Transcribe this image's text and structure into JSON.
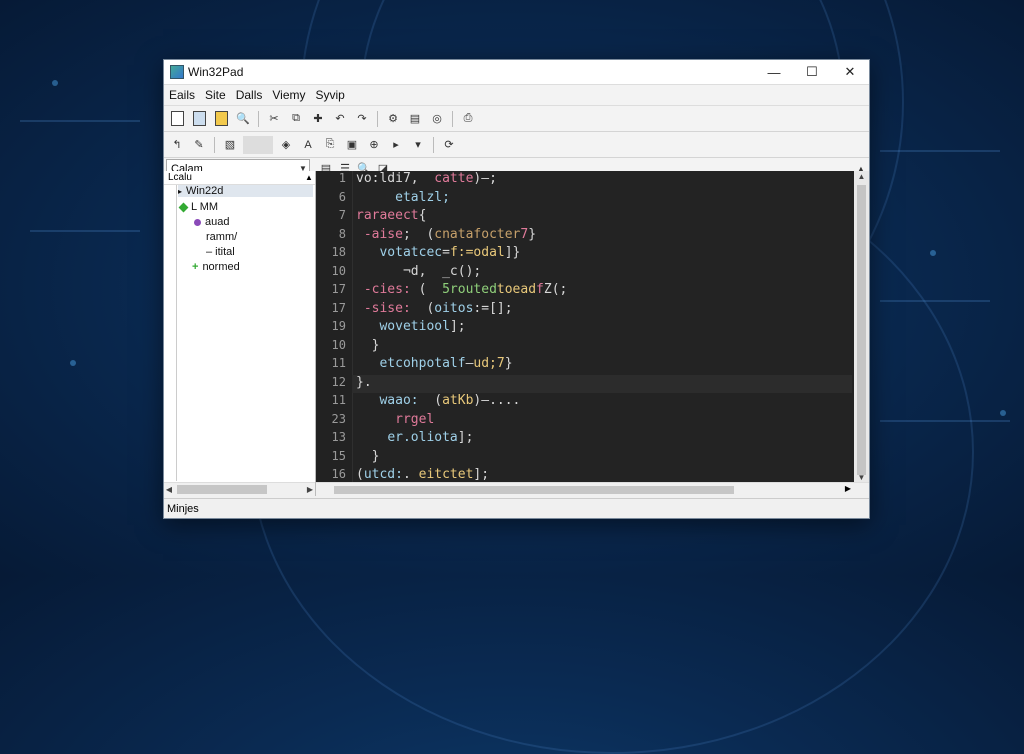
{
  "window": {
    "title": "Win32Pad",
    "controls": {
      "minimize": "—",
      "maximize": "☐",
      "close": "✕"
    }
  },
  "menu": [
    "Eails",
    "Site",
    "Dalls",
    "Viemy",
    "Syvip"
  ],
  "addressbar": {
    "combo_value": "Calam"
  },
  "tree": {
    "header": "Lcalu",
    "items": [
      {
        "label": "Win22d",
        "marker": "",
        "selected": true
      },
      {
        "label": "L  MM",
        "marker": "green"
      },
      {
        "label": "auad",
        "marker": "purple"
      },
      {
        "label": "ramm/",
        "marker": ""
      },
      {
        "label": "– itital",
        "marker": ""
      },
      {
        "label": "normed",
        "marker": "green-plus"
      }
    ]
  },
  "editor": {
    "line_numbers": [
      "1",
      "6",
      "7",
      "8",
      "18",
      "10",
      "17",
      "17",
      "19",
      "10",
      "11",
      "12",
      "11",
      "23",
      "13",
      "15",
      "16"
    ],
    "current_line_index": 11,
    "lines": [
      {
        "parts": [
          [
            "",
            "vo:ldi7,  "
          ],
          [
            "kw",
            "catte"
          ],
          [
            "",
            ")–;"
          ]
        ]
      },
      {
        "parts": [
          [
            "",
            "     "
          ],
          [
            "cy",
            "etalzl;"
          ]
        ]
      },
      {
        "parts": [
          [
            "kw",
            "raraeect"
          ],
          [
            "",
            "{"
          ]
        ]
      },
      {
        "parts": [
          [
            "",
            " "
          ],
          [
            "kw",
            "-aise"
          ],
          [
            "",
            ";  ("
          ],
          [
            "str",
            "cnatafocter"
          ],
          [
            "kw",
            "7"
          ],
          [
            "",
            "}"
          ]
        ]
      },
      {
        "parts": [
          [
            "",
            "   "
          ],
          [
            "cy",
            "votatcec"
          ],
          [
            "",
            "="
          ],
          [
            "fn",
            "f:=odal"
          ],
          [
            "",
            "]}"
          ]
        ]
      },
      {
        "parts": [
          [
            "",
            "      "
          ],
          [
            "",
            "¬d,  _c();"
          ]
        ]
      },
      {
        "parts": [
          [
            "",
            " "
          ],
          [
            "kw",
            "-cies:"
          ],
          [
            "",
            " (  "
          ],
          [
            "grn",
            "5routed"
          ],
          [
            "fn",
            "toead"
          ],
          [
            "kw",
            "f"
          ],
          [
            "",
            "Z(;"
          ]
        ]
      },
      {
        "parts": [
          [
            "",
            " "
          ],
          [
            "kw",
            "-sise:"
          ],
          [
            "",
            "  ("
          ],
          [
            "cy",
            "oitos"
          ],
          [
            "",
            ":=[];"
          ]
        ]
      },
      {
        "parts": [
          [
            "",
            "   "
          ],
          [
            "cy",
            "wovetiool"
          ],
          [
            "",
            "];"
          ]
        ]
      },
      {
        "parts": [
          [
            "",
            "  }"
          ]
        ]
      },
      {
        "parts": [
          [
            "",
            "   "
          ],
          [
            "cy",
            "etcohpotalf"
          ],
          [
            "",
            "–"
          ],
          [
            "fn",
            "ud;7"
          ],
          [
            "",
            "}"
          ]
        ]
      },
      {
        "parts": [
          [
            "",
            "}."
          ]
        ]
      },
      {
        "parts": [
          [
            "",
            "   "
          ],
          [
            "cy",
            "waao:"
          ],
          [
            "",
            "  ("
          ],
          [
            "fn",
            "atKb"
          ],
          [
            "",
            ")–...."
          ]
        ]
      },
      {
        "parts": [
          [
            "",
            "     "
          ],
          [
            "kw",
            "rrgel"
          ]
        ]
      },
      {
        "parts": [
          [
            "",
            "    "
          ],
          [
            "cy",
            "er.oliota"
          ],
          [
            "",
            "];"
          ]
        ]
      },
      {
        "parts": [
          [
            "",
            "  }"
          ]
        ]
      },
      {
        "parts": [
          [
            "",
            "("
          ],
          [
            "cy",
            "utcd:"
          ],
          [
            "",
            ". "
          ],
          [
            "fn",
            "eitctet"
          ],
          [
            "",
            "];"
          ]
        ]
      }
    ]
  },
  "status": {
    "text": "Minjes"
  },
  "colors": {
    "background": "#0a2a52",
    "editor_bg": "#232323",
    "keyword": "#e07a9a",
    "string": "#c6a06a"
  }
}
